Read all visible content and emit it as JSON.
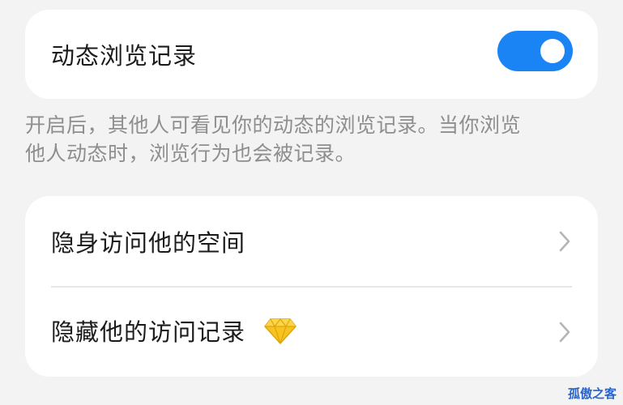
{
  "browse_record": {
    "label": "动态浏览记录",
    "toggle_on": true
  },
  "description": {
    "line1": "开启后，其他人可看见你的动态的浏览记录。当你浏览",
    "line2": "他人动态时，浏览行为也会被记录。"
  },
  "menu": {
    "items": [
      {
        "label": "隐身访问他的空间",
        "icon": "chevron-right-icon"
      },
      {
        "label": "隐藏他的访问记录",
        "badge_icon": "diamond-icon",
        "icon": "chevron-right-icon"
      }
    ]
  },
  "watermark": "孤傲之客",
  "colors": {
    "accent": "#1a84f4",
    "background": "#f3f3f3",
    "card": "#ffffff",
    "secondary_text": "#8e8e8e",
    "diamond": "#f7c31e"
  }
}
